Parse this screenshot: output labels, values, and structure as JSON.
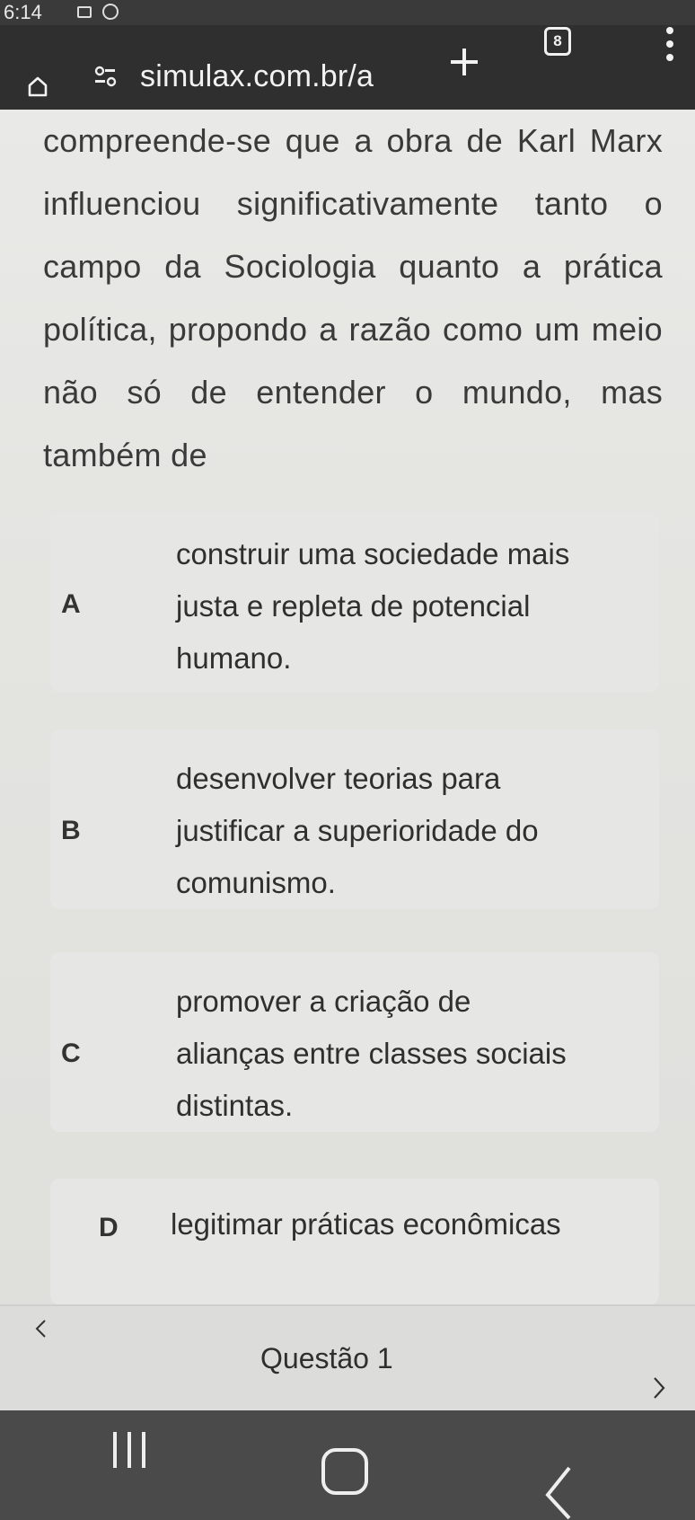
{
  "status_bar": {
    "time": "6:14"
  },
  "browser": {
    "url": "simulax.com.br/a",
    "tab_count": "8",
    "icons": [
      "home-icon",
      "site-info-icon",
      "new-tab-plus-icon",
      "tabs-counter",
      "more-menu-icon"
    ]
  },
  "question": {
    "stem_lines": [
      "compreende-se que a obra de Karl Marx",
      "influenciou significativamente tanto o",
      "campo da Sociologia quanto a prática",
      "política, propondo a razão como um meio",
      "não só de entender o mundo, mas",
      "também de"
    ],
    "options": [
      {
        "letter": "A",
        "lines": [
          "construir uma sociedade mais",
          "justa e repleta de potencial",
          "humano."
        ]
      },
      {
        "letter": "B",
        "lines": [
          "desenvolver teorias para",
          "justificar a superioridade do",
          "comunismo."
        ]
      },
      {
        "letter": "C",
        "lines": [
          "promover a criação de",
          "alianças entre classes sociais",
          "distintas."
        ]
      },
      {
        "letter": "D",
        "lines": [
          "legitimar práticas econômicas"
        ]
      }
    ]
  },
  "navigator": {
    "label": "Questão 1",
    "icons": [
      "previous-chevron-icon",
      "next-chevron-icon"
    ]
  },
  "system_nav": {
    "icons": [
      "recents-icon",
      "home-button-icon",
      "back-icon"
    ]
  }
}
